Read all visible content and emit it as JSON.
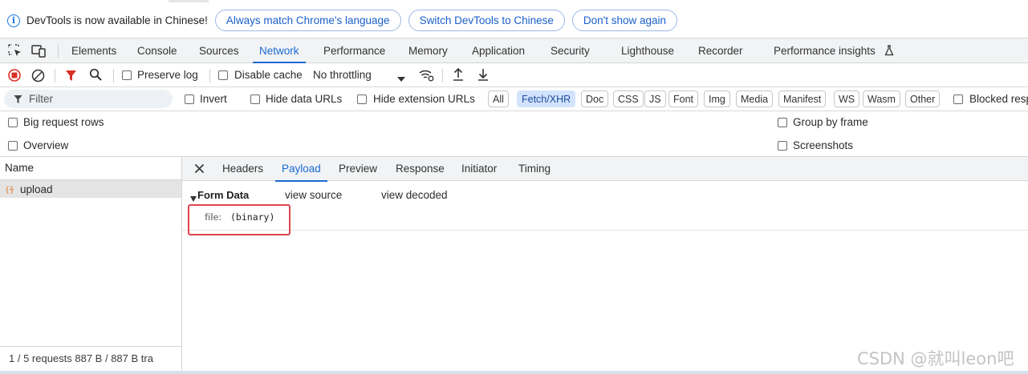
{
  "infobar": {
    "message": "DevTools is now available in Chinese!",
    "buttons": [
      "Always match Chrome's language",
      "Switch DevTools to Chinese",
      "Don't show again"
    ]
  },
  "main_tabs": [
    "Elements",
    "Console",
    "Sources",
    "Network",
    "Performance",
    "Memory",
    "Application",
    "Security",
    "Lighthouse",
    "Recorder",
    "Performance insights"
  ],
  "active_main_tab": "Network",
  "toolbar": {
    "preserve_log": "Preserve log",
    "disable_cache": "Disable cache",
    "throttling": "No throttling"
  },
  "filter": {
    "placeholder": "Filter",
    "invert": "Invert",
    "hide_data_urls": "Hide data URLs",
    "hide_extension_urls": "Hide extension URLs",
    "types": [
      "All",
      "Fetch/XHR",
      "Doc",
      "CSS",
      "JS",
      "Font",
      "Img",
      "Media",
      "Manifest",
      "WS",
      "Wasm",
      "Other"
    ],
    "active_type": "Fetch/XHR",
    "blocked": "Blocked resp"
  },
  "options": {
    "big_request_rows": "Big request rows",
    "overview": "Overview",
    "group_by_frame": "Group by frame",
    "screenshots": "Screenshots"
  },
  "request_list": {
    "header": "Name",
    "items": [
      {
        "name": "upload",
        "icon": "xhr-icon"
      }
    ],
    "status": "1 / 5 requests    887 B / 887 B tra"
  },
  "detail": {
    "tabs": [
      "Headers",
      "Payload",
      "Preview",
      "Response",
      "Initiator",
      "Timing"
    ],
    "active_tab": "Payload",
    "section_title": "Form Data",
    "view_source": "view source",
    "view_decoded": "view decoded",
    "field_key": "file:",
    "field_value": "(binary)"
  },
  "watermark": "CSDN @就叫leon吧",
  "colors": {
    "accent": "#1a73e8",
    "record_red": "#d93025",
    "highlight_box": "#e0454f"
  }
}
